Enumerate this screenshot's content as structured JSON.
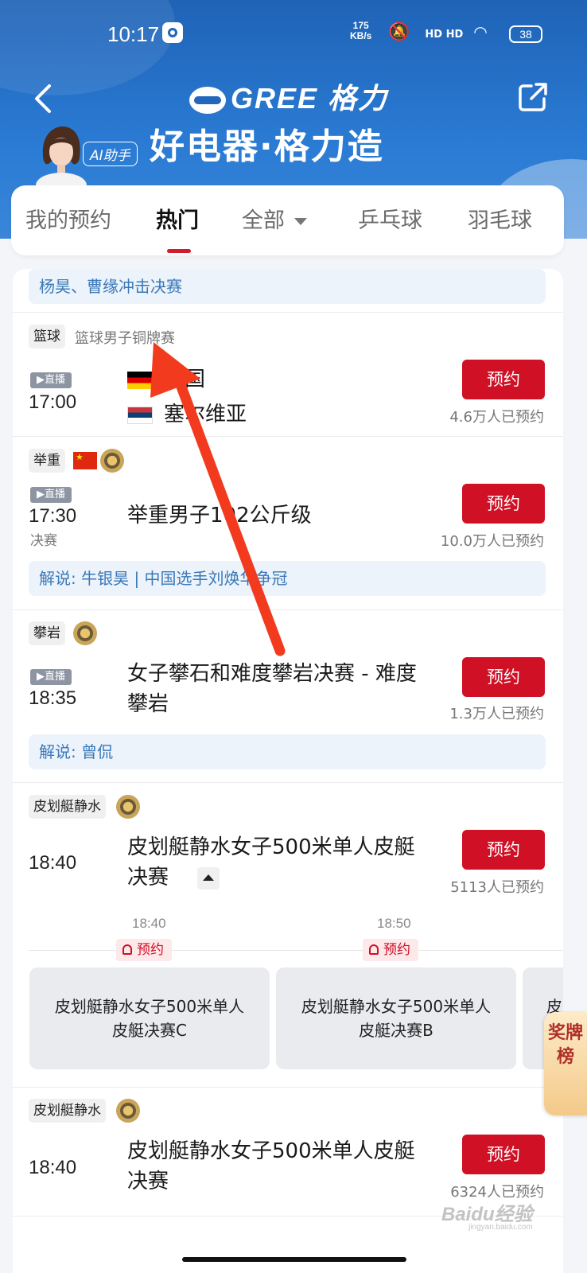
{
  "status_bar": {
    "time": "10:17",
    "speed_value": "175",
    "speed_unit": "KB/s",
    "signal_labels": "HD HD",
    "battery": "38"
  },
  "header": {
    "brand": "GREE 格力",
    "slogan": "好电器·格力造",
    "ai_badge": "AI助手"
  },
  "tabs": [
    "我的预约",
    "热门",
    "全部",
    "乒乓球",
    "羽毛球"
  ],
  "active_tab": "热门",
  "events": [
    {
      "note": "杨昊、曹缘冲击决赛"
    },
    {
      "sport": "篮球",
      "name": "篮球男子铜牌赛",
      "live": "直播",
      "time": "17:00",
      "team1": "德国",
      "team2": "塞尔维亚",
      "button": "预约",
      "count": "4.6万人已预约"
    },
    {
      "sport": "举重",
      "live": "直播",
      "time": "17:30",
      "stage": "决赛",
      "title": "举重男子102公斤级",
      "button": "预约",
      "count": "10.0万人已预约",
      "commentary": "解说: 牛银昊 | 中国选手刘焕华争冠"
    },
    {
      "sport": "攀岩",
      "live": "直播",
      "time": "18:35",
      "title": "女子攀石和难度攀岩决赛 - 难度攀岩",
      "button": "预约",
      "count": "1.3万人已预约",
      "commentary": "解说: 曾侃"
    },
    {
      "sport": "皮划艇静水",
      "time": "18:40",
      "title": "皮划艇静水女子500米单人皮艇决赛",
      "button": "预约",
      "count": "5113人已预约",
      "timeline": [
        {
          "time": "18:40",
          "reserve": "预约",
          "title": "皮划艇静水女子500米单人皮艇决赛C"
        },
        {
          "time": "18:50",
          "reserve": "预约",
          "title": "皮划艇静水女子500米单人皮艇决赛B"
        }
      ],
      "peek_text": "皮"
    },
    {
      "sport": "皮划艇静水",
      "time": "18:40",
      "title": "皮划艇静水女子500米单人皮艇决赛",
      "button": "预约",
      "count": "6324人已预约"
    }
  ],
  "side_tab": "奖牌榜",
  "watermark": {
    "main": "Baidu经验",
    "sub": "jingyan.baidu.com"
  },
  "colors": {
    "header_blue": "#1f63b6",
    "accent_red": "#cf1025",
    "note_bg": "#ecf3fb",
    "note_text": "#3a78b8",
    "annotation_arrow": "#f23b1e"
  }
}
